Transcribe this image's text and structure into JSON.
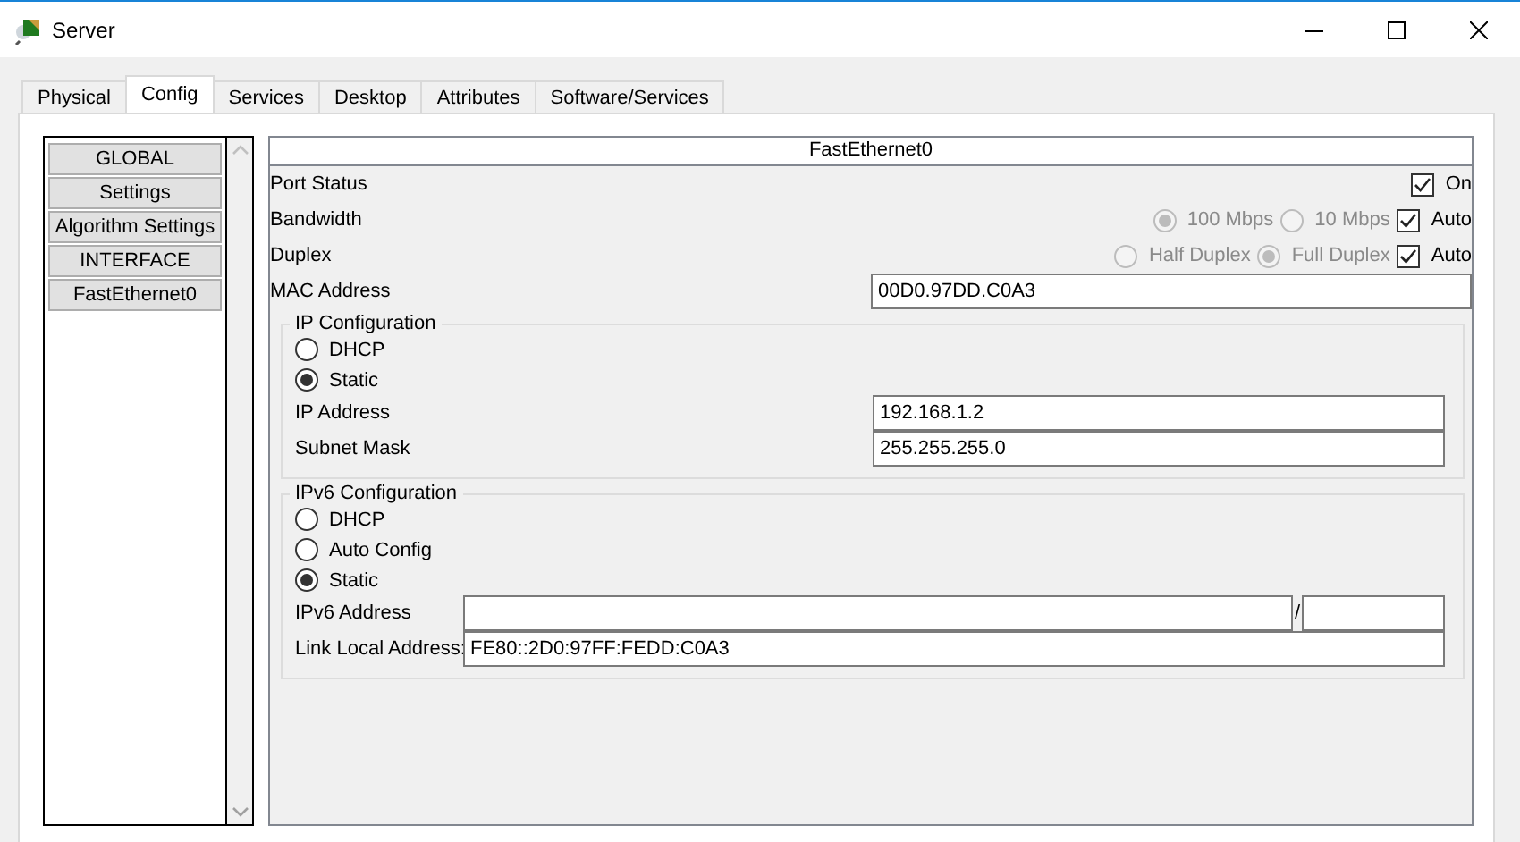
{
  "window": {
    "title": "Server"
  },
  "tabs": [
    {
      "label": "Physical",
      "selected": false
    },
    {
      "label": "Config",
      "selected": true
    },
    {
      "label": "Services",
      "selected": false
    },
    {
      "label": "Desktop",
      "selected": false
    },
    {
      "label": "Attributes",
      "selected": false
    },
    {
      "label": "Software/Services",
      "selected": false
    }
  ],
  "sidebar": {
    "items": [
      {
        "label": "GLOBAL",
        "selected": false
      },
      {
        "label": "Settings",
        "selected": false
      },
      {
        "label": "Algorithm Settings",
        "selected": false
      },
      {
        "label": "INTERFACE",
        "selected": false
      },
      {
        "label": "FastEthernet0",
        "selected": false
      }
    ]
  },
  "interface": {
    "title": "FastEthernet0",
    "port_status": {
      "label": "Port Status",
      "toggle": {
        "label": "On",
        "checked": true
      }
    },
    "bandwidth": {
      "label": "Bandwidth",
      "options": [
        {
          "label": "100 Mbps",
          "selected": true,
          "disabled": true
        },
        {
          "label": "10 Mbps",
          "selected": false,
          "disabled": true
        }
      ],
      "auto": {
        "label": "Auto",
        "checked": true
      }
    },
    "duplex": {
      "label": "Duplex",
      "options": [
        {
          "label": "Half Duplex",
          "selected": false,
          "disabled": true
        },
        {
          "label": "Full Duplex",
          "selected": true,
          "disabled": true
        }
      ],
      "auto": {
        "label": "Auto",
        "checked": true
      }
    },
    "mac": {
      "label": "MAC Address",
      "value": "00D0.97DD.C0A3"
    },
    "ip_config": {
      "title": "IP Configuration",
      "modes": [
        {
          "label": "DHCP",
          "selected": false
        },
        {
          "label": "Static",
          "selected": true
        }
      ],
      "fields": [
        {
          "label": "IP Address",
          "value": "192.168.1.2"
        },
        {
          "label": "Subnet Mask",
          "value": "255.255.255.0"
        }
      ]
    },
    "ipv6_config": {
      "title": "IPv6 Configuration",
      "modes": [
        {
          "label": "DHCP",
          "selected": false
        },
        {
          "label": "Auto Config",
          "selected": false
        },
        {
          "label": "Static",
          "selected": true
        }
      ],
      "address": {
        "label": "IPv6 Address",
        "separator": "/"
      },
      "link_local": {
        "label": "Link Local Address:",
        "value": "FE80::2D0:97FF:FEDD:C0A3"
      }
    }
  }
}
